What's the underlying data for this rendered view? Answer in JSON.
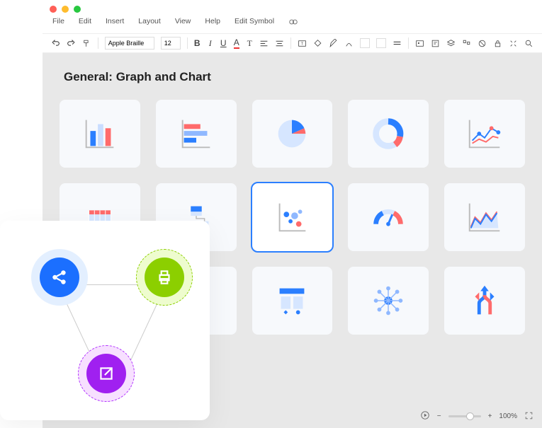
{
  "menu": {
    "file": "File",
    "edit": "Edit",
    "insert": "Insert",
    "layout": "Layout",
    "view": "View",
    "help": "Help",
    "edit_symbol": "Edit Symbol"
  },
  "toolbar": {
    "font_name": "Apple Braille",
    "font_size": "12"
  },
  "canvas": {
    "title": "General: Graph and Chart"
  },
  "shapes": [
    {
      "id": "bar-chart",
      "selected": false
    },
    {
      "id": "horizontal-bar-chart",
      "selected": false
    },
    {
      "id": "pie-chart",
      "selected": false
    },
    {
      "id": "donut-chart",
      "selected": false
    },
    {
      "id": "line-chart",
      "selected": false
    },
    {
      "id": "table-chart",
      "selected": false
    },
    {
      "id": "org-chart",
      "selected": false
    },
    {
      "id": "scatter-chart",
      "selected": true
    },
    {
      "id": "gauge-chart",
      "selected": false
    },
    {
      "id": "area-chart",
      "selected": false
    },
    {
      "id": "diamond-shape",
      "selected": false
    },
    {
      "id": "flowchart",
      "selected": false
    },
    {
      "id": "network-chart",
      "selected": false
    },
    {
      "id": "merge-arrows",
      "selected": false
    }
  ],
  "status": {
    "zoom_label": "100%"
  },
  "overlay_nodes": {
    "share": "share-icon",
    "print": "print-icon",
    "open": "open-external-icon"
  }
}
